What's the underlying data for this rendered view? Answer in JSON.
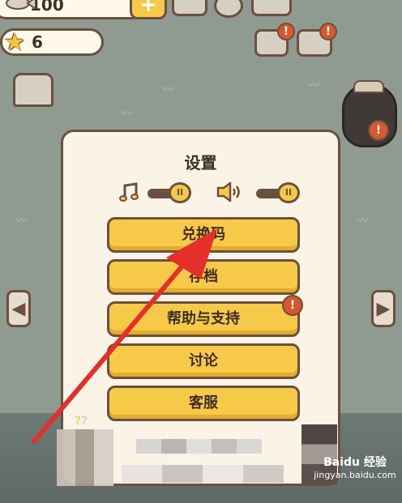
{
  "hud": {
    "fish_count": "100",
    "star_count": "6",
    "plus_label": "+",
    "fish_icon": "fish-icon",
    "star_icon": "star-icon",
    "badge_mark": "!"
  },
  "dialog": {
    "title": "设置",
    "music_icon": "music-note-icon",
    "sound_icon": "speaker-icon",
    "toggle_mark": "II",
    "buttons": [
      {
        "label": "兑换码"
      },
      {
        "label": "存档"
      },
      {
        "label": "帮助与支持"
      },
      {
        "label": "讨论"
      },
      {
        "label": "客服"
      }
    ]
  },
  "nav": {
    "prev_glyph": "◀",
    "next_glyph": "▶"
  },
  "watermark": {
    "main": "Baidu 经验",
    "sub": "jingyan.baidu.com"
  },
  "colors": {
    "background": "#8f9b91",
    "panel": "#fbf4e6",
    "button": "#f7c949",
    "outline": "#6b4f3f",
    "badge": "#d9572c",
    "annotation_arrow": "#e3302b"
  }
}
